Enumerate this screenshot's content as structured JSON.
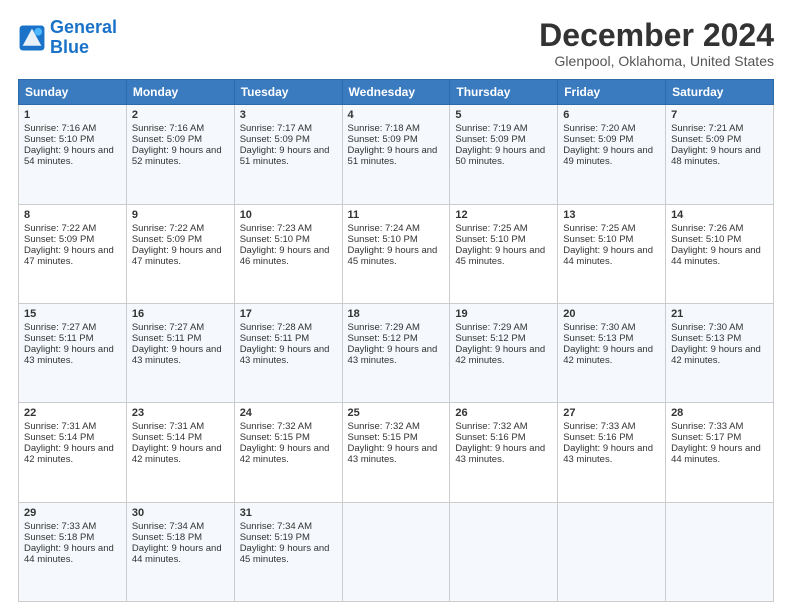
{
  "header": {
    "logo_line1": "General",
    "logo_line2": "Blue",
    "month": "December 2024",
    "location": "Glenpool, Oklahoma, United States"
  },
  "days_of_week": [
    "Sunday",
    "Monday",
    "Tuesday",
    "Wednesday",
    "Thursday",
    "Friday",
    "Saturday"
  ],
  "weeks": [
    [
      {
        "day": "1",
        "sunrise": "7:16 AM",
        "sunset": "5:10 PM",
        "daylight": "9 hours and 54 minutes."
      },
      {
        "day": "2",
        "sunrise": "7:16 AM",
        "sunset": "5:09 PM",
        "daylight": "9 hours and 52 minutes."
      },
      {
        "day": "3",
        "sunrise": "7:17 AM",
        "sunset": "5:09 PM",
        "daylight": "9 hours and 51 minutes."
      },
      {
        "day": "4",
        "sunrise": "7:18 AM",
        "sunset": "5:09 PM",
        "daylight": "9 hours and 51 minutes."
      },
      {
        "day": "5",
        "sunrise": "7:19 AM",
        "sunset": "5:09 PM",
        "daylight": "9 hours and 50 minutes."
      },
      {
        "day": "6",
        "sunrise": "7:20 AM",
        "sunset": "5:09 PM",
        "daylight": "9 hours and 49 minutes."
      },
      {
        "day": "7",
        "sunrise": "7:21 AM",
        "sunset": "5:09 PM",
        "daylight": "9 hours and 48 minutes."
      }
    ],
    [
      {
        "day": "8",
        "sunrise": "7:22 AM",
        "sunset": "5:09 PM",
        "daylight": "9 hours and 47 minutes."
      },
      {
        "day": "9",
        "sunrise": "7:22 AM",
        "sunset": "5:09 PM",
        "daylight": "9 hours and 47 minutes."
      },
      {
        "day": "10",
        "sunrise": "7:23 AM",
        "sunset": "5:10 PM",
        "daylight": "9 hours and 46 minutes."
      },
      {
        "day": "11",
        "sunrise": "7:24 AM",
        "sunset": "5:10 PM",
        "daylight": "9 hours and 45 minutes."
      },
      {
        "day": "12",
        "sunrise": "7:25 AM",
        "sunset": "5:10 PM",
        "daylight": "9 hours and 45 minutes."
      },
      {
        "day": "13",
        "sunrise": "7:25 AM",
        "sunset": "5:10 PM",
        "daylight": "9 hours and 44 minutes."
      },
      {
        "day": "14",
        "sunrise": "7:26 AM",
        "sunset": "5:10 PM",
        "daylight": "9 hours and 44 minutes."
      }
    ],
    [
      {
        "day": "15",
        "sunrise": "7:27 AM",
        "sunset": "5:11 PM",
        "daylight": "9 hours and 43 minutes."
      },
      {
        "day": "16",
        "sunrise": "7:27 AM",
        "sunset": "5:11 PM",
        "daylight": "9 hours and 43 minutes."
      },
      {
        "day": "17",
        "sunrise": "7:28 AM",
        "sunset": "5:11 PM",
        "daylight": "9 hours and 43 minutes."
      },
      {
        "day": "18",
        "sunrise": "7:29 AM",
        "sunset": "5:12 PM",
        "daylight": "9 hours and 43 minutes."
      },
      {
        "day": "19",
        "sunrise": "7:29 AM",
        "sunset": "5:12 PM",
        "daylight": "9 hours and 42 minutes."
      },
      {
        "day": "20",
        "sunrise": "7:30 AM",
        "sunset": "5:13 PM",
        "daylight": "9 hours and 42 minutes."
      },
      {
        "day": "21",
        "sunrise": "7:30 AM",
        "sunset": "5:13 PM",
        "daylight": "9 hours and 42 minutes."
      }
    ],
    [
      {
        "day": "22",
        "sunrise": "7:31 AM",
        "sunset": "5:14 PM",
        "daylight": "9 hours and 42 minutes."
      },
      {
        "day": "23",
        "sunrise": "7:31 AM",
        "sunset": "5:14 PM",
        "daylight": "9 hours and 42 minutes."
      },
      {
        "day": "24",
        "sunrise": "7:32 AM",
        "sunset": "5:15 PM",
        "daylight": "9 hours and 42 minutes."
      },
      {
        "day": "25",
        "sunrise": "7:32 AM",
        "sunset": "5:15 PM",
        "daylight": "9 hours and 43 minutes."
      },
      {
        "day": "26",
        "sunrise": "7:32 AM",
        "sunset": "5:16 PM",
        "daylight": "9 hours and 43 minutes."
      },
      {
        "day": "27",
        "sunrise": "7:33 AM",
        "sunset": "5:16 PM",
        "daylight": "9 hours and 43 minutes."
      },
      {
        "day": "28",
        "sunrise": "7:33 AM",
        "sunset": "5:17 PM",
        "daylight": "9 hours and 44 minutes."
      }
    ],
    [
      {
        "day": "29",
        "sunrise": "7:33 AM",
        "sunset": "5:18 PM",
        "daylight": "9 hours and 44 minutes."
      },
      {
        "day": "30",
        "sunrise": "7:34 AM",
        "sunset": "5:18 PM",
        "daylight": "9 hours and 44 minutes."
      },
      {
        "day": "31",
        "sunrise": "7:34 AM",
        "sunset": "5:19 PM",
        "daylight": "9 hours and 45 minutes."
      },
      {
        "day": "",
        "sunrise": "",
        "sunset": "",
        "daylight": ""
      },
      {
        "day": "",
        "sunrise": "",
        "sunset": "",
        "daylight": ""
      },
      {
        "day": "",
        "sunrise": "",
        "sunset": "",
        "daylight": ""
      },
      {
        "day": "",
        "sunrise": "",
        "sunset": "",
        "daylight": ""
      }
    ]
  ],
  "labels": {
    "sunrise": "Sunrise:",
    "sunset": "Sunset:",
    "daylight": "Daylight:"
  }
}
